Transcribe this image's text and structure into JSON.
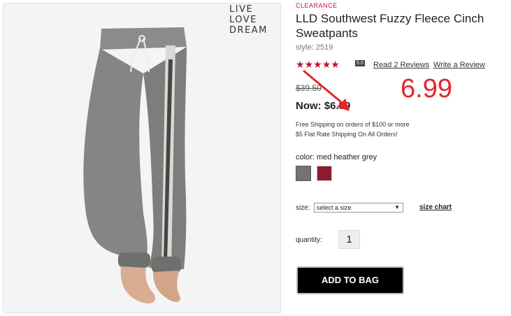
{
  "brand": {
    "logo_lines": [
      "LIVE",
      "LOVE",
      "DREAM"
    ]
  },
  "product": {
    "clearance_label": "CLEARANCE",
    "title": "LLD Southwest Fuzzy Fleece Cinch Sweatpants",
    "style": "style: 2519",
    "rating": {
      "stars": 5,
      "score": "5.0"
    },
    "read_reviews": "Read 2 Reviews",
    "write_review": "Write a Review",
    "old_price": "$39.50",
    "now_price": "Now: $6.99",
    "annotation_price": "6.99"
  },
  "shipping": {
    "line1": "Free Shipping on orders of $100 or more",
    "line2": "$5 Flat Rate Shipping On All Orders!"
  },
  "color": {
    "label": "color: med heather grey",
    "swatches": [
      {
        "name": "med heather grey",
        "hex": "#75736f"
      },
      {
        "name": "red",
        "hex": "#8e1c2e"
      }
    ]
  },
  "size": {
    "label": "size:",
    "selected": "select a size",
    "chart_link": "size chart"
  },
  "quantity": {
    "label": "quantity:",
    "value": "1"
  },
  "add_to_bag": "ADD TO BAG",
  "colors": {
    "accent_red": "#c8102e",
    "annotation_red": "#e8232a"
  }
}
